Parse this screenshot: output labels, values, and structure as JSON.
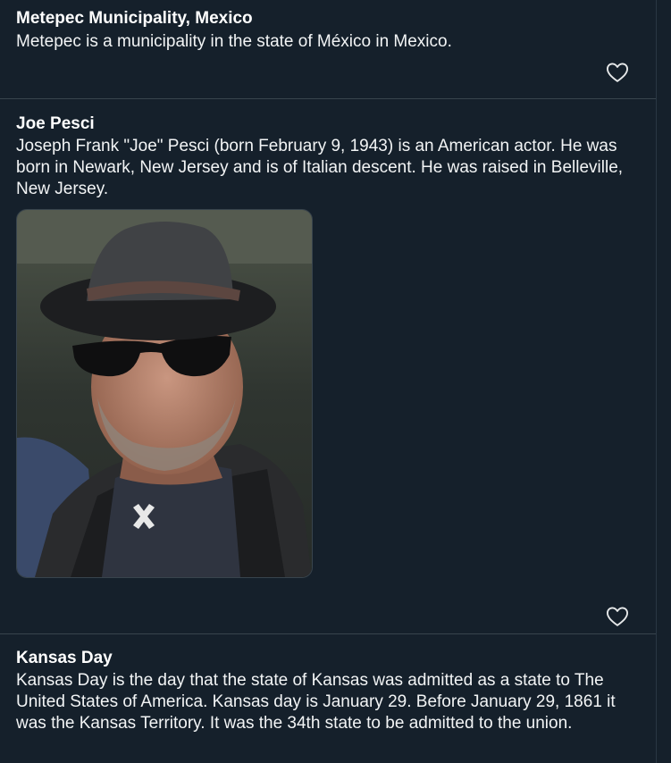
{
  "posts": [
    {
      "title": "Metepec Municipality, Mexico",
      "body": "Metepec is a municipality in the state of México in Mexico."
    },
    {
      "title": "Joe Pesci",
      "body": "Joseph Frank \"Joe\" Pesci (born February 9, 1943) is an American actor. He was born in Newark, New Jersey and is of Italian descent. He was raised in Belleville, New Jersey."
    },
    {
      "title": "Kansas Day",
      "body": "Kansas Day is the day that the state of Kansas was admitted as a state to The United States of America. Kansas day is January 29. Before January 29, 1861 it was the Kansas Territory. It was the 34th state to be admitted to the union."
    }
  ],
  "icons": {
    "like": "heart-outline-icon"
  },
  "colors": {
    "background": "#15202b",
    "divider": "#38444d",
    "text": "#ffffff"
  }
}
